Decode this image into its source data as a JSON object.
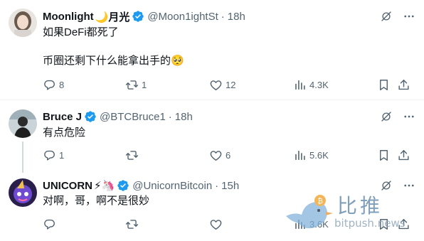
{
  "tweets": [
    {
      "name": "Moonlight",
      "name_suffix": "🌙月光",
      "handle": "@Moon1ightSt",
      "time": "18h",
      "text": "如果DeFi都死了\n\n币圈还剩下什么能拿出手的🥺",
      "stats": {
        "replies": "8",
        "retweets": "1",
        "likes": "12",
        "views": "4.3K"
      }
    },
    {
      "name": "Bruce J",
      "name_suffix": "",
      "handle": "@BTCBruce1",
      "time": "18h",
      "text": "有点危险",
      "stats": {
        "replies": "1",
        "retweets": "",
        "likes": "6",
        "views": "5.6K"
      }
    },
    {
      "name": "UNICORN",
      "name_suffix": "⚡🦄",
      "handle": "@UnicornBitcoin",
      "time": "15h",
      "text": "对啊，哥，啊不是很妙",
      "stats": {
        "replies": "",
        "retweets": "",
        "likes": "",
        "views": "3.6K"
      }
    }
  ],
  "watermark": {
    "cn": "比推",
    "en": "bitpush.news"
  },
  "colors": {
    "verified": "#1d9bf0",
    "muted": "#536471",
    "text": "#0f1419",
    "divider": "#eff3f4"
  }
}
